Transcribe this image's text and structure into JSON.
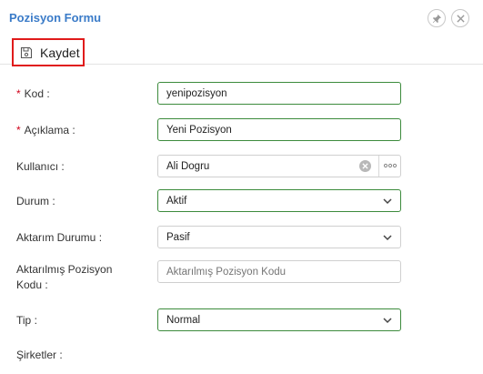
{
  "window": {
    "title": "Pozisyon Formu"
  },
  "toolbar": {
    "save_label": "Kaydet"
  },
  "form": {
    "kod": {
      "label": "Kod",
      "value": "yenipozisyon"
    },
    "aciklama": {
      "label": "Açıklama",
      "value": "Yeni Pozisyon"
    },
    "kullanici": {
      "label": "Kullanıcı",
      "value": "Ali Dogru"
    },
    "durum": {
      "label": "Durum",
      "value": "Aktif"
    },
    "aktarim_durumu": {
      "label": "Aktarım Durumu",
      "value": "Pasif"
    },
    "aktarilmis_kodu": {
      "label_line1": "Aktarılmış Pozisyon",
      "label_line2": "Kodu",
      "placeholder": "Aktarılmış Pozisyon Kodu"
    },
    "tip": {
      "label": "Tip",
      "value": "Normal"
    },
    "sirketler": {
      "label": "Şirketler"
    }
  },
  "colors": {
    "title": "#3a7bc8",
    "highlight": "#e01b1b",
    "valid": "#3c8b3c",
    "required": "#d0021b"
  },
  "icons": {
    "pin": "pin-icon",
    "close": "close-icon",
    "save": "save-icon",
    "chevron": "chevron-down-icon",
    "clear": "clear-icon",
    "more": "ellipsis-icon"
  }
}
